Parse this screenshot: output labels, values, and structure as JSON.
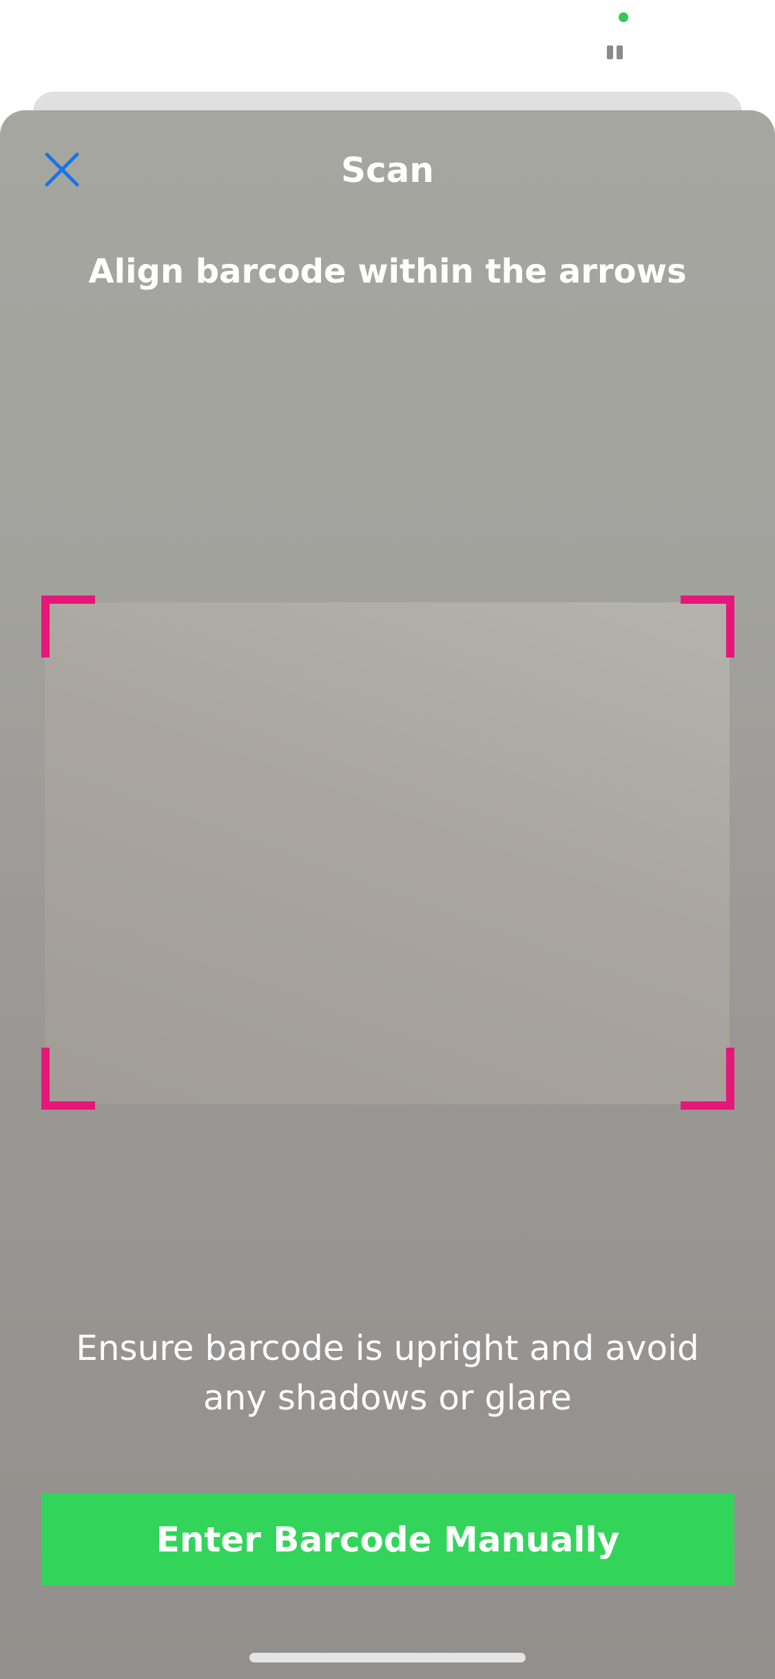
{
  "header": {
    "title": "Scan",
    "close_icon": "close-icon"
  },
  "scanner": {
    "instruction": "Align barcode within the arrows",
    "hint": "Ensure barcode is upright and avoid any shadows or glare",
    "corner_color": "#e6177a"
  },
  "actions": {
    "manual_entry_label": "Enter Barcode Manually",
    "button_color": "#32d55a"
  },
  "colors": {
    "accent_blue": "#1a73e8",
    "camera_indicator": "#34c759"
  },
  "icons": [
    "camera-indicator",
    "pause-icon",
    "close-icon",
    "home-indicator"
  ]
}
